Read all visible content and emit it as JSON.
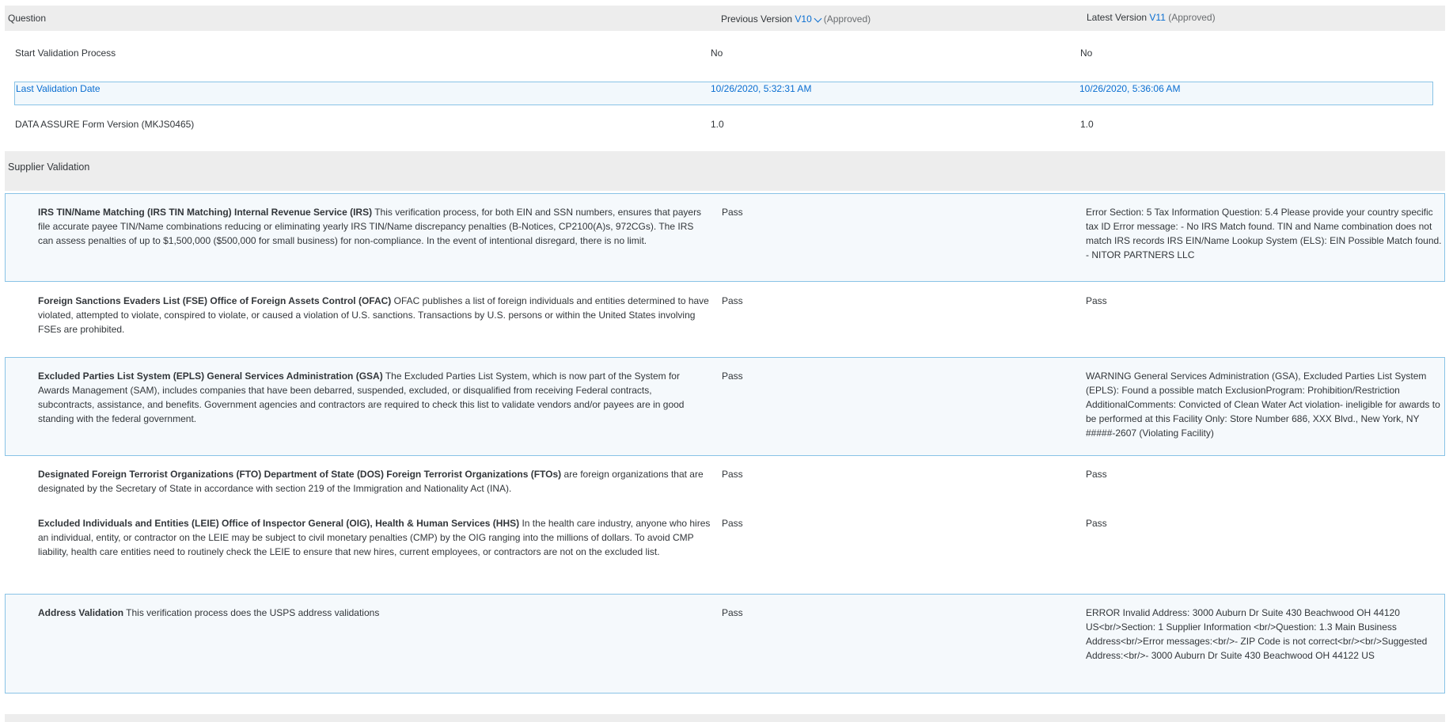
{
  "header": {
    "question_label": "Question",
    "previous_label": "Previous Version",
    "previous_version": "V10",
    "previous_status": "(Approved)",
    "latest_label": "Latest Version",
    "latest_version": "V11",
    "latest_status": "(Approved)"
  },
  "rows": [
    {
      "question": "Start Validation Process",
      "previous": "No",
      "latest": "No"
    },
    {
      "question": "Last Validation Date",
      "previous": "10/26/2020, 5:32:31 AM",
      "latest": "10/26/2020, 5:36:06 AM"
    },
    {
      "question": "DATA ASSURE Form Version (MKJS0465)",
      "previous": "1.0",
      "latest": "1.0"
    }
  ],
  "section": {
    "title": "Supplier Validation",
    "items": [
      {
        "title": "IRS TIN/Name Matching (IRS TIN Matching) Internal Revenue Service (IRS)",
        "description": "This verification process, for both EIN and SSN numbers, ensures that payers file accurate payee TIN/Name combinations reducing or eliminating yearly IRS TIN/Name discrepancy penalties (B-Notices, CP2100(A)s, 972CGs). The IRS can assess penalties of up to $1,500,000 ($500,000 for small business) for non-compliance. In the event of intentional disregard, there is no limit.",
        "previous": "Pass",
        "latest": "Error Section: 5 Tax Information Question: 5.4 Please provide your country specific tax ID Error message: - No IRS Match found. TIN and Name combination does not match IRS records  IRS EIN/Name Lookup System (ELS): EIN Possible Match found. - NITOR PARTNERS LLC"
      },
      {
        "title": "Foreign Sanctions Evaders List (FSE) Office of Foreign Assets Control (OFAC)",
        "description": "OFAC publishes a list of foreign individuals and entities determined to have violated, attempted to violate, conspired to violate, or caused a violation of U.S. sanctions. Transactions by U.S. persons or within the United States involving FSEs are prohibited.",
        "previous": "Pass",
        "latest": "Pass"
      },
      {
        "title": "Excluded Parties List System (EPLS) General Services Administration (GSA)",
        "description": "The Excluded Parties List System, which is now part of the System for Awards Management (SAM), includes companies that have been debarred, suspended, excluded, or disqualified from receiving Federal contracts, subcontracts, assistance, and benefits. Government agencies and contractors are required to check this list to validate vendors and/or payees are in good standing with the federal government.",
        "previous": "Pass",
        "latest": "WARNING General Services Administration (GSA), Excluded Parties List System (EPLS): Found a possible match ExclusionProgram: Prohibition/Restriction AdditionalComments: Convicted of Clean Water Act violation- ineligible for awards to be performed at this Facility Only: Store Number 686, XXX Blvd., New York, NY #####-2607 (Violating Facility)"
      },
      {
        "title": "Designated Foreign Terrorist Organizations (FTO) Department of State (DOS) Foreign Terrorist Organizations (FTOs)",
        "description": "are foreign organizations that are designated by the Secretary of State in accordance with section 219 of the Immigration and Nationality Act (INA).",
        "previous": "Pass",
        "latest": "Pass"
      },
      {
        "title": "Excluded Individuals and Entities (LEIE) Office of Inspector General (OIG), Health & Human Services (HHS)",
        "description": "In the health care industry, anyone who hires an individual, entity, or contractor on the LEIE may be subject to civil monetary penalties (CMP) by the OIG ranging into the millions of dollars. To avoid CMP liability, health care entities need to routinely check the LEIE to ensure that new hires, current employees, or contractors are not on the excluded list.",
        "previous": "Pass",
        "latest": "Pass"
      },
      {
        "title": "Address Validation",
        "description": "This verification process does the USPS address validations",
        "previous": "Pass",
        "latest": "ERROR Invalid Address: 3000 Auburn Dr Suite 430 Beachwood OH 44120 US<br/>Section: 1 Supplier Information <br/>Question: 1.3 Main Business Address<br/>Error messages:<br/>- ZIP Code is not correct<br/><br/>Suggested Address:<br/>- 3000 Auburn Dr Suite 430 Beachwood OH 44122 US"
      }
    ]
  }
}
